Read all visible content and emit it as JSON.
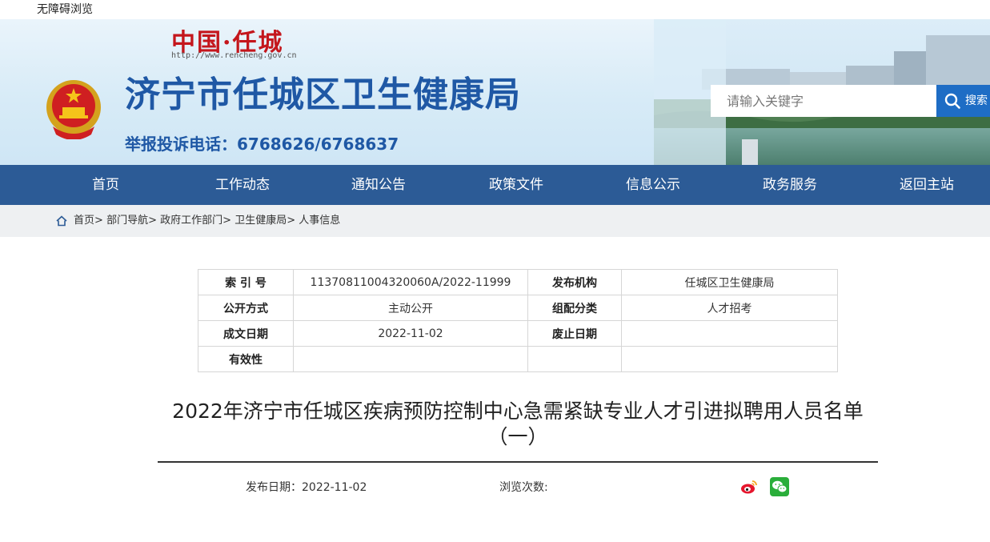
{
  "topbar": {
    "accessibility_label": "无障碍浏览"
  },
  "header": {
    "logo_text": "中国·任城",
    "logo_url": "http://www.rencheng.gov.cn",
    "title": "济宁市任城区卫生健康局",
    "hotline": "举报投诉电话：6768626/6768637",
    "search": {
      "placeholder": "请输入关键字",
      "button_label": "搜索"
    }
  },
  "nav": {
    "items": [
      {
        "label": "首页"
      },
      {
        "label": "工作动态"
      },
      {
        "label": "通知公告"
      },
      {
        "label": "政策文件"
      },
      {
        "label": "信息公示"
      },
      {
        "label": "政务服务"
      },
      {
        "label": "返回主站"
      }
    ]
  },
  "breadcrumb": {
    "items": [
      "首页",
      "部门导航",
      "政府工作部门",
      "卫生健康局",
      "人事信息"
    ],
    "separator": ">"
  },
  "meta_table": {
    "rows": [
      {
        "k1": "索 引 号",
        "v1": "11370811004320060A/2022-11999",
        "k2": "发布机构",
        "v2": "任城区卫生健康局"
      },
      {
        "k1": "公开方式",
        "v1": "主动公开",
        "k2": "组配分类",
        "v2": "人才招考"
      },
      {
        "k1": "成文日期",
        "v1": "2022-11-02",
        "k2": "废止日期",
        "v2": ""
      },
      {
        "k1": "有效性",
        "v1": "",
        "k2": "",
        "v2": ""
      }
    ]
  },
  "article": {
    "title_line1": "2022年济宁市任城区疾病预防控制中心急需紧缺专业人才引进拟聘用人员名单",
    "title_line2": "（一）",
    "publish_date": "发布日期：2022-11-02",
    "views_label": "浏览次数:"
  },
  "share": {
    "icons": [
      "weibo-icon",
      "wechat-icon"
    ]
  },
  "colors": {
    "brand_blue": "#1f58a5",
    "nav_bg": "#2c5b96",
    "search_btn": "#1e6dc5",
    "logo_red": "#c4161c"
  }
}
